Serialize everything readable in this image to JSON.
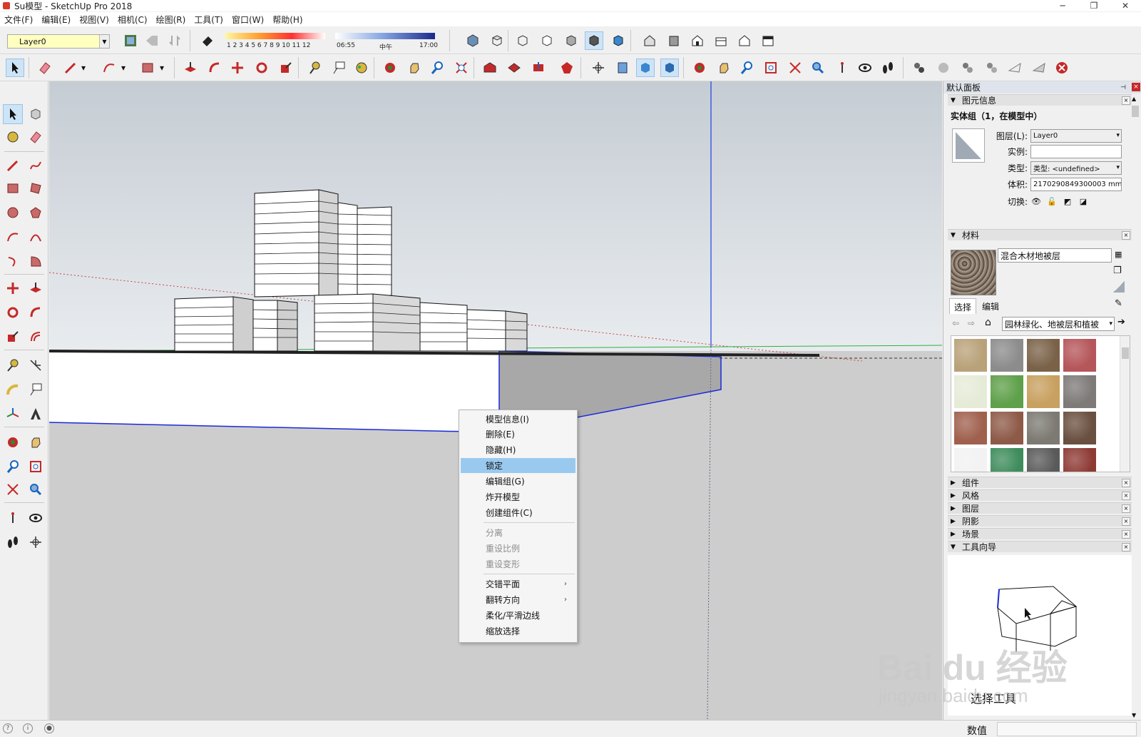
{
  "window": {
    "title": "Su模型 - SketchUp Pro 2018",
    "minimize": "─",
    "restore": "❐",
    "close": "✕"
  },
  "menu": [
    "文件(F)",
    "编辑(E)",
    "视图(V)",
    "相机(C)",
    "绘图(R)",
    "工具(T)",
    "窗口(W)",
    "帮助(H)"
  ],
  "layer_toolbar": {
    "current_layer": "Layer0"
  },
  "shadow_toolbar": {
    "month_labels": "1 2 3 4 5 6 7 8 9 10 11 12",
    "time_start": "06:55",
    "time_mid": "中午",
    "time_end": "17:00"
  },
  "context_menu": {
    "items": [
      {
        "label": "模型信息(I)",
        "state": "normal"
      },
      {
        "label": "删除(E)",
        "state": "normal"
      },
      {
        "label": "隐藏(H)",
        "state": "normal"
      },
      {
        "label": "锁定",
        "state": "highlighted"
      },
      {
        "label": "编辑组(G)",
        "state": "normal"
      },
      {
        "label": "炸开模型",
        "state": "normal"
      },
      {
        "label": "创建组件(C)",
        "state": "normal"
      },
      {
        "label": "分离",
        "state": "disabled"
      },
      {
        "label": "重设比例",
        "state": "disabled"
      },
      {
        "label": "重设变形",
        "state": "disabled"
      },
      {
        "label": "交错平面",
        "state": "submenu"
      },
      {
        "label": "翻转方向",
        "state": "submenu"
      },
      {
        "label": "柔化/平滑边线",
        "state": "normal"
      },
      {
        "label": "缩放选择",
        "state": "normal"
      }
    ],
    "submenu_arrow": "›"
  },
  "tray": {
    "title": "默认面板",
    "pin": "⊣",
    "close": "×",
    "entity_info": {
      "header": "图元信息",
      "title": "实体组（1，在模型中）",
      "layer_label": "图层(L):",
      "layer_value": "Layer0",
      "instance_label": "实例:",
      "instance_value": "",
      "type_label": "类型:",
      "type_value": "类型: <undefined>",
      "volume_label": "体积:",
      "volume_value": "2170290849300003 mm³",
      "toggle_label": "切换:"
    },
    "materials": {
      "header": "材料",
      "name": "混合木材地被层",
      "tab_select": "选择",
      "tab_edit": "编辑",
      "library": "园林绿化、地被层和植被",
      "swatch_colors": [
        "#b9a27a",
        "#8c8c8c",
        "#7a6248",
        "#b5565a",
        "#e6ebd8",
        "#5fa04a",
        "#c8a060",
        "#7d7a78",
        "#a0604e",
        "#8e5a48",
        "#7c7a72",
        "#6a5040",
        "#f2f2f2",
        "#3e8c5c",
        "#5a5a5a",
        "#8e3a34"
      ]
    },
    "collapsed_sections": [
      "组件",
      "风格",
      "图层",
      "阴影",
      "场景"
    ],
    "instructor": {
      "header": "工具向导",
      "tool_title": "选择工具"
    }
  },
  "watermark": {
    "logo": "Bai   du 经验",
    "url": "jingyan.baidu.com"
  },
  "status": {
    "measurements_label": "数值",
    "measurements_value": ""
  }
}
